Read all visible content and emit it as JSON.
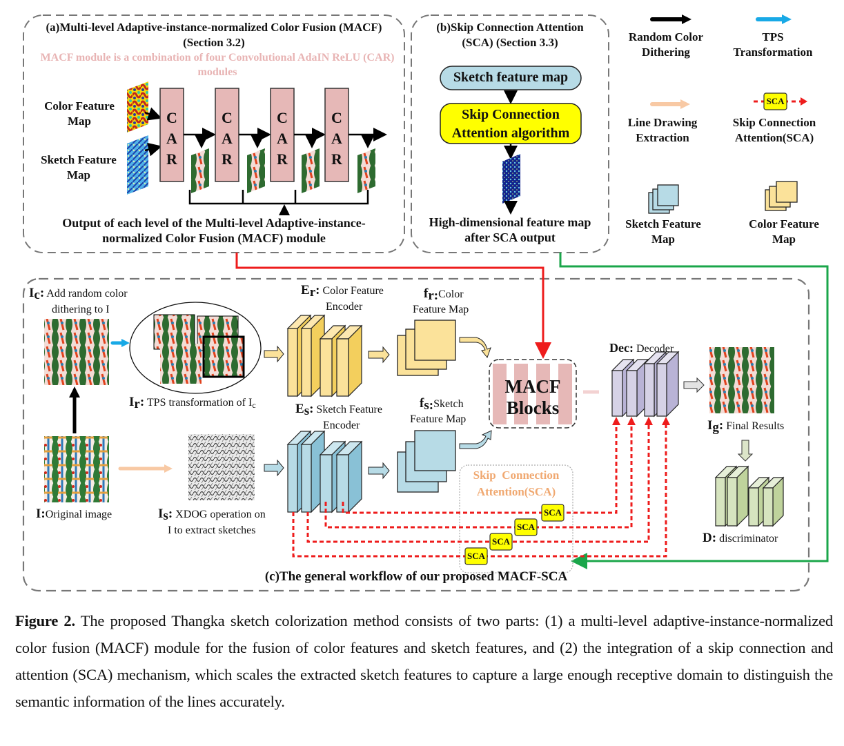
{
  "panel_a": {
    "title_line1": "(a)Multi-level Adaptive-instance-normalized Color Fusion (MACF)",
    "title_line2": "(Section 3.2)",
    "note_line1": "MACF module is a combination of four Convolutional AdaIN ReLU (CAR)",
    "note_line2": "modules",
    "color_input_label": [
      "Color Feature",
      "Map"
    ],
    "sketch_input_label": [
      "Sketch Feature",
      "Map"
    ],
    "car_blocks": [
      {
        "letters": [
          "C",
          "A",
          "R"
        ]
      },
      {
        "letters": [
          "C",
          "A",
          "R"
        ]
      },
      {
        "letters": [
          "C",
          "A",
          "R"
        ]
      },
      {
        "letters": [
          "C",
          "A",
          "R"
        ]
      }
    ],
    "output_line1": "Output of each level of the Multi-level Adaptive-instance-",
    "output_line2": "normalized Color Fusion (MACF) module"
  },
  "panel_b": {
    "title_line1": "(b)Skip Connection Attention",
    "title_line2": "(SCA) (Section 3.3)",
    "sketch_box": "Sketch feature map",
    "algo_line1": "Skip Connection",
    "algo_line2": "Attention algorithm",
    "output_line1": "High-dimensional feature map",
    "output_line2": "after SCA output"
  },
  "legend": {
    "items": [
      {
        "label": [
          "Random Color",
          "Dithering"
        ],
        "icon": "black-arrow-icon"
      },
      {
        "label": [
          "TPS",
          "Transformation"
        ],
        "icon": "blue-arrow-icon"
      },
      {
        "label": [
          "Line Drawing",
          "Extraction"
        ],
        "icon": "peach-arrow-icon"
      },
      {
        "label": [
          "Skip Connection",
          "Attention(SCA)"
        ],
        "icon": "sca-dashed-arrow-icon",
        "badge": "SCA"
      },
      {
        "label": [
          "Sketch Feature",
          "Map"
        ],
        "icon": "blue-stack-icon"
      },
      {
        "label": [
          "Color Feature",
          "Map"
        ],
        "icon": "yellow-stack-icon"
      }
    ]
  },
  "panel_c": {
    "ic_symbol": "I",
    "ic_sub": "c",
    "ic_line1": "Add random color",
    "ic_line2": "dithering to I",
    "ir_symbol": "I",
    "ir_sub": "r",
    "ir_text": "TPS transformation of I",
    "ir_text_sub": "c",
    "i_symbol": "I",
    "i_text": "Original image",
    "is_symbol": "I",
    "is_sub": "s",
    "is_line1": "XDOG operation on",
    "is_line2": "I to extract sketches",
    "er_symbol": "E",
    "er_sub": "r",
    "er_line1": "Color Feature",
    "er_line2": "Encoder",
    "fr_symbol": "f",
    "fr_sub": "r:",
    "fr_line1": "Color",
    "fr_line2": "Feature Map",
    "es_symbol": "E",
    "es_sub": "s",
    "es_line1": "Sketch Feature",
    "es_line2": "Encoder",
    "fs_symbol": "f",
    "fs_sub": "s:",
    "fs_line1": "Sketch",
    "fs_line2": "Feature Map",
    "macf_line1": "MACF",
    "macf_line2": "Blocks",
    "dec_symbol": "Dec:",
    "dec_text": "Decoder",
    "ig_symbol": "I",
    "ig_sub": "g",
    "ig_text": "Final Results",
    "d_symbol": "D:",
    "d_text": "discriminator",
    "sca_group_line1": "Skip  Connection",
    "sca_group_line2": "Attention(SCA)",
    "sca_badges": [
      "SCA",
      "SCA",
      "SCA",
      "SCA"
    ],
    "title": "(c)The general workflow of our proposed MACF-SCA"
  },
  "colors": {
    "car_fill": "#e6b8b7",
    "yellow_block": "#fbe29a",
    "blue_block": "#b7dbe6",
    "purple_block": "#d6d2e6",
    "green_block": "#d6e4bf",
    "red_arrow": "#ee1c1c",
    "green_arrow": "#1aa64a",
    "tps_blue": "#18a9e6",
    "peach": "#f8c9a4",
    "sca_yellow": "#ffff00"
  },
  "caption": {
    "label": "Figure 2.",
    "text": " The proposed Thangka sketch colorization method consists of two parts: (1) a multi-level adaptive-instance-normalized color fusion (MACF) module for the fusion of color features and sketch features, and (2) the integration of a skip connection and attention (SCA) mechanism, which scales the extracted sketch features to capture a large enough receptive domain to distinguish the semantic information of the lines accurately."
  }
}
